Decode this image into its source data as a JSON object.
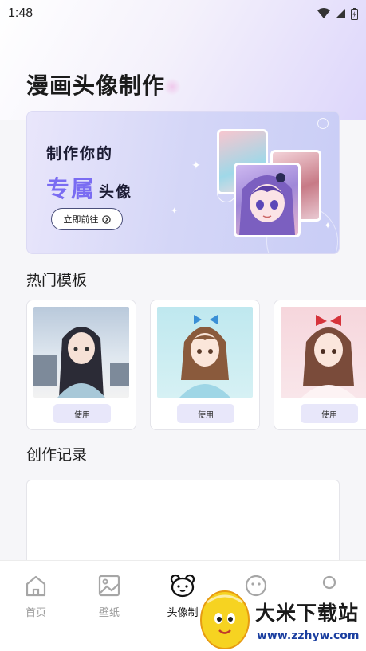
{
  "status_bar": {
    "time": "1:48"
  },
  "page_title": "漫画头像制作",
  "banner": {
    "line1": "制作你的",
    "line2_highlight": "专属",
    "line2_rest": "头像",
    "button_label": "立即前往"
  },
  "hot_templates": {
    "title": "热门模板",
    "items": [
      {
        "name": "template-1",
        "use_label": "使用"
      },
      {
        "name": "template-2",
        "use_label": "使用"
      },
      {
        "name": "template-3",
        "use_label": "使用"
      }
    ]
  },
  "records": {
    "title": "创作记录"
  },
  "bottom_nav": {
    "items": [
      {
        "label": "首页",
        "icon": "home-icon",
        "active": false
      },
      {
        "label": "壁纸",
        "icon": "image-icon",
        "active": false
      },
      {
        "label": "头像制",
        "icon": "bear-face-icon",
        "active": true
      },
      {
        "label": "",
        "icon": "smiley-icon",
        "active": false
      },
      {
        "label": "",
        "icon": "profile-icon",
        "active": false
      }
    ]
  },
  "watermark": {
    "brand": "大米下载站",
    "url": "www.zzhyw.com"
  },
  "colors": {
    "accent": "#7a6cf2",
    "banner_bg": "#d4d6f7",
    "use_button_bg": "#e8e7fa"
  }
}
